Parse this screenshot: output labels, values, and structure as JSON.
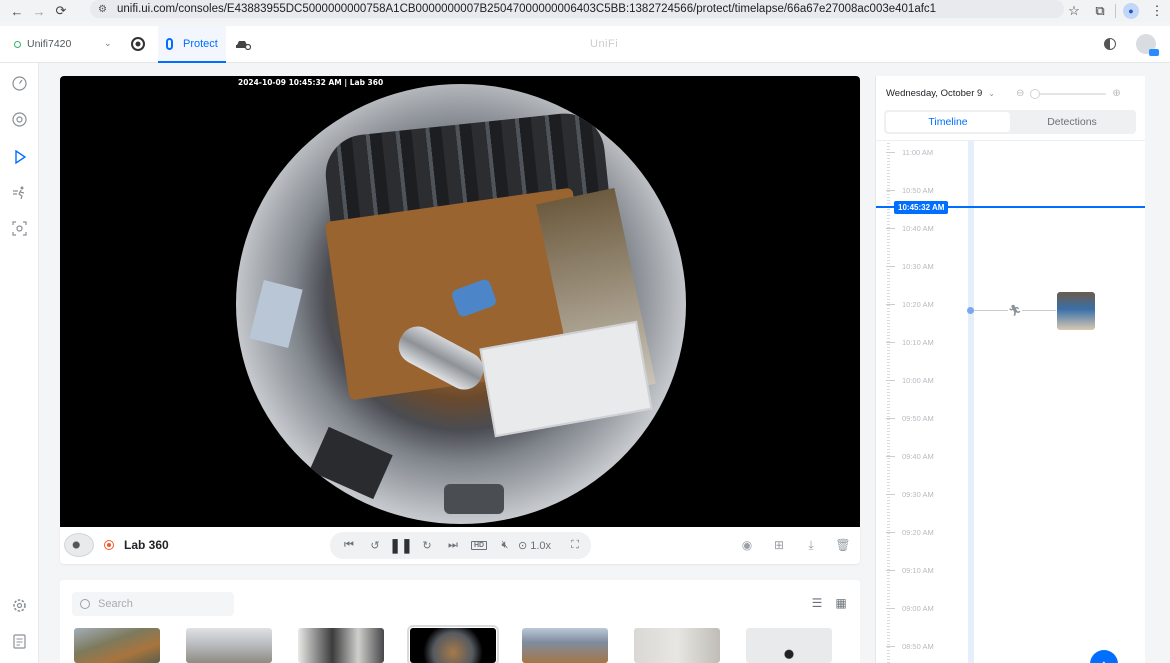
{
  "browser": {
    "url": "unifi.ui.com/consoles/E43883955DC5000000000758A1CB0000000007B25047000000006403C5BB:1382724566/protect/timelapse/66a67e27008ac003e401afc1"
  },
  "header": {
    "console_name": "Unifi7420",
    "app_label": "Protect",
    "logo_text": "UniFi"
  },
  "video": {
    "overlay_timestamp": "2024-10-09 10:45:32 AM | Lab 360"
  },
  "player": {
    "camera_name": "Lab 360",
    "speed_label": "1.0x"
  },
  "camera_list": {
    "search_placeholder": "Search"
  },
  "timeline": {
    "date_label": "Wednesday, October 9",
    "tabs": [
      {
        "label": "Timeline",
        "active": true
      },
      {
        "label": "Detections",
        "active": false
      }
    ],
    "cursor_time": "10:45:32 AM",
    "ticks": [
      "11:00 AM",
      "10:50 AM",
      "10:40 AM",
      "10:30 AM",
      "10:20 AM",
      "10:10 AM",
      "10:00 AM",
      "09:50 AM",
      "09:40 AM",
      "09:30 AM",
      "09:20 AM",
      "09:10 AM",
      "09:00 AM",
      "08:50 AM"
    ]
  },
  "colors": {
    "accent": "#006fff",
    "recording": "#f05a2b",
    "online": "#38b36b"
  },
  "icons": {
    "back": "arrow-left-icon",
    "forward": "arrow-right-icon",
    "reload": "reload-icon",
    "site_info": "tune-icon",
    "bookmark": "star-icon",
    "extensions": "puzzle-icon",
    "profile": "person-icon",
    "menu": "kebab-icon"
  }
}
